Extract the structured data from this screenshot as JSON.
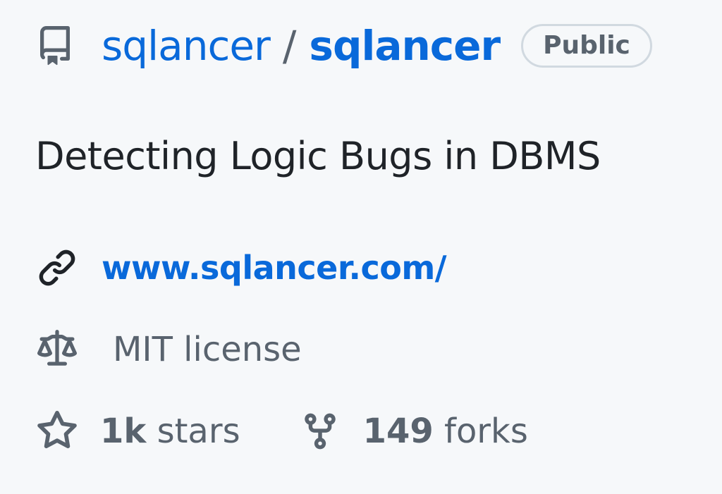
{
  "repo": {
    "owner": "sqlancer",
    "separator": "/",
    "name": "sqlancer",
    "visibility": "Public",
    "description": "Detecting Logic Bugs in DBMS",
    "website": "www.sqlancer.com/",
    "license": "MIT license"
  },
  "stats": {
    "stars_count": "1k",
    "stars_label": " stars",
    "forks_count": "149",
    "forks_label": " forks"
  },
  "icons": {
    "repo": "repo-icon",
    "link": "link-icon",
    "license": "law-scale-icon",
    "stars": "star-icon",
    "forks": "repo-forked-icon"
  },
  "colors": {
    "link": "#0969da",
    "muted": "#59636e",
    "text": "#1f2328",
    "background": "#f6f8fa",
    "badge_border": "#d1d9e0"
  }
}
